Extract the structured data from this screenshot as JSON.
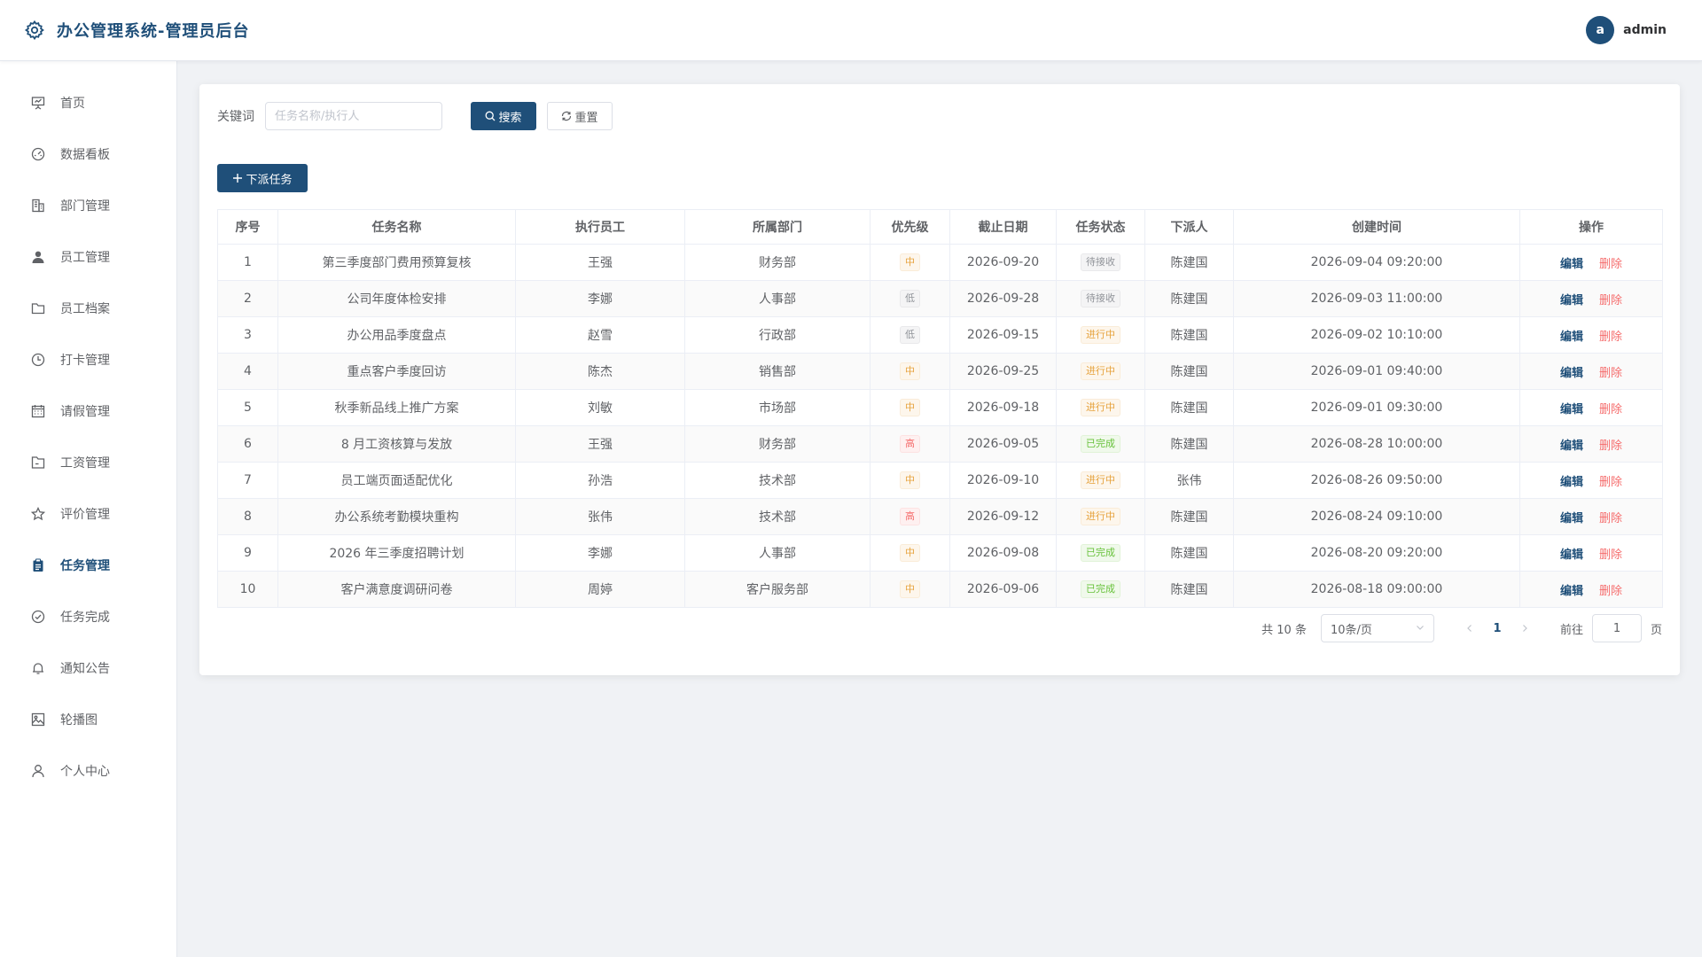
{
  "header": {
    "title": "办公管理系统-管理员后台",
    "avatar_letter": "a",
    "username": "admin",
    "logo_icon": "gear-icon",
    "brand_color": "#1f4f79"
  },
  "sidebar": {
    "items": [
      {
        "label": "首页",
        "icon": "presentation-icon"
      },
      {
        "label": "数据看板",
        "icon": "dashboard-icon"
      },
      {
        "label": "部门管理",
        "icon": "building-icon"
      },
      {
        "label": "员工管理",
        "icon": "user-filled-icon"
      },
      {
        "label": "员工档案",
        "icon": "folder-icon"
      },
      {
        "label": "打卡管理",
        "icon": "clock-icon"
      },
      {
        "label": "请假管理",
        "icon": "calendar-icon"
      },
      {
        "label": "工资管理",
        "icon": "briefcase-icon"
      },
      {
        "label": "评价管理",
        "icon": "star-icon"
      },
      {
        "label": "任务管理",
        "icon": "clipboard-icon",
        "active": true
      },
      {
        "label": "任务完成",
        "icon": "check-circle-icon"
      },
      {
        "label": "通知公告",
        "icon": "bell-icon"
      },
      {
        "label": "轮播图",
        "icon": "picture-icon"
      },
      {
        "label": "个人中心",
        "icon": "user-icon"
      }
    ]
  },
  "search": {
    "keyword_label": "关键词",
    "placeholder": "任务名称/执行人",
    "value": "",
    "search_label": "搜索",
    "reset_label": "重置"
  },
  "toolbar": {
    "assign_label": "下派任务"
  },
  "table": {
    "columns": [
      "序号",
      "任务名称",
      "执行员工",
      "所属部门",
      "优先级",
      "截止日期",
      "任务状态",
      "下派人",
      "创建时间",
      "操作"
    ],
    "edit_label": "编辑",
    "delete_label": "删除",
    "rows": [
      {
        "no": "1",
        "name": "第三季度部门费用预算复核",
        "staff": "王强",
        "dept": "财务部",
        "priority": "中",
        "deadline": "2026-09-20",
        "status": "待接收",
        "assigner": "陈建国",
        "created": "2026-09-04 09:20:00"
      },
      {
        "no": "2",
        "name": "公司年度体检安排",
        "staff": "李娜",
        "dept": "人事部",
        "priority": "低",
        "deadline": "2026-09-28",
        "status": "待接收",
        "assigner": "陈建国",
        "created": "2026-09-03 11:00:00"
      },
      {
        "no": "3",
        "name": "办公用品季度盘点",
        "staff": "赵雪",
        "dept": "行政部",
        "priority": "低",
        "deadline": "2026-09-15",
        "status": "进行中",
        "assigner": "陈建国",
        "created": "2026-09-02 10:10:00"
      },
      {
        "no": "4",
        "name": "重点客户季度回访",
        "staff": "陈杰",
        "dept": "销售部",
        "priority": "中",
        "deadline": "2026-09-25",
        "status": "进行中",
        "assigner": "陈建国",
        "created": "2026-09-01 09:40:00"
      },
      {
        "no": "5",
        "name": "秋季新品线上推广方案",
        "staff": "刘敏",
        "dept": "市场部",
        "priority": "中",
        "deadline": "2026-09-18",
        "status": "进行中",
        "assigner": "陈建国",
        "created": "2026-09-01 09:30:00"
      },
      {
        "no": "6",
        "name": "8 月工资核算与发放",
        "staff": "王强",
        "dept": "财务部",
        "priority": "高",
        "deadline": "2026-09-05",
        "status": "已完成",
        "assigner": "陈建国",
        "created": "2026-08-28 10:00:00"
      },
      {
        "no": "7",
        "name": "员工端页面适配优化",
        "staff": "孙浩",
        "dept": "技术部",
        "priority": "中",
        "deadline": "2026-09-10",
        "status": "进行中",
        "assigner": "张伟",
        "created": "2026-08-26 09:50:00"
      },
      {
        "no": "8",
        "name": "办公系统考勤模块重构",
        "staff": "张伟",
        "dept": "技术部",
        "priority": "高",
        "deadline": "2026-09-12",
        "status": "进行中",
        "assigner": "陈建国",
        "created": "2026-08-24 09:10:00"
      },
      {
        "no": "9",
        "name": "2026 年三季度招聘计划",
        "staff": "李娜",
        "dept": "人事部",
        "priority": "中",
        "deadline": "2026-09-08",
        "status": "已完成",
        "assigner": "陈建国",
        "created": "2026-08-20 09:20:00"
      },
      {
        "no": "10",
        "name": "客户满意度调研问卷",
        "staff": "周婷",
        "dept": "客户服务部",
        "priority": "中",
        "deadline": "2026-09-06",
        "status": "已完成",
        "assigner": "陈建国",
        "created": "2026-08-18 09:00:00"
      }
    ]
  },
  "pagination": {
    "total_text": "共 10 条",
    "page_size": "10条/页",
    "current_page": "1",
    "goto_label": "前往",
    "goto_value": "1",
    "page_suffix": "页"
  },
  "colors": {
    "primary": "#1f4f79",
    "danger": "#f56c6c",
    "warning": "#e6a23c",
    "success": "#67c23a",
    "info": "#909399"
  }
}
